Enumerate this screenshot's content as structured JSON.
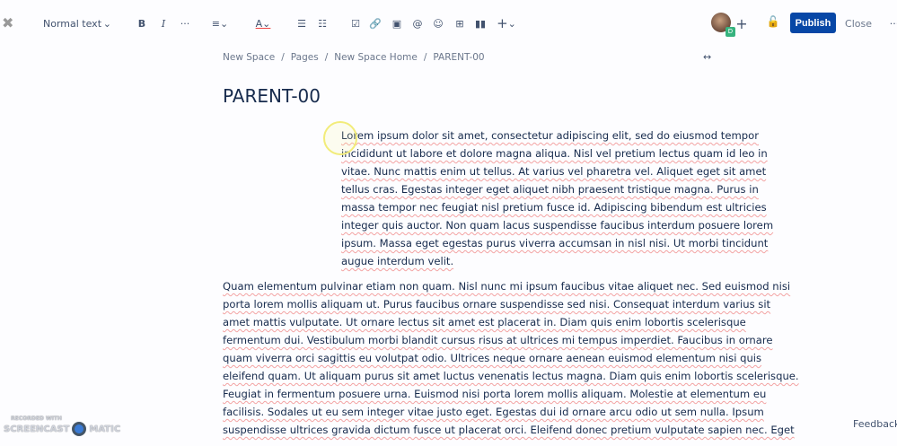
{
  "toolbar": {
    "text_style": "Normal text",
    "bold": "B",
    "italic": "I",
    "more": "···",
    "plus": "+"
  },
  "header": {
    "publish": "Publish",
    "close": "Close",
    "avatar_badge": "D"
  },
  "breadcrumb": [
    "New Space",
    "Pages",
    "New Space Home",
    "PARENT-00"
  ],
  "page_title": "PARENT-00",
  "paragraphs": [
    {
      "lines": [
        "Lorem ipsum dolor sit amet, consectetur adipiscing elit, sed do eiusmod tempor",
        "incididunt ut labore et dolore magna aliqua. Nisl vel pretium lectus quam id leo in",
        "vitae. Nunc mattis enim ut tellus. At varius vel pharetra vel. Aliquet eget sit amet",
        "tellus cras. Egestas integer eget aliquet nibh praesent tristique magna. Purus in",
        "massa tempor nec feugiat nisl pretium fusce id. Adipiscing bibendum est ultricies",
        "integer quis auctor. Non quam lacus suspendisse faucibus interdum posuere lorem",
        "ipsum. Massa eget egestas purus viverra accumsan in nisl nisi. Ut morbi tincidunt",
        "augue interdum velit."
      ]
    },
    {
      "lines": [
        "Quam elementum pulvinar etiam non quam. Nisl nunc mi ipsum faucibus vitae aliquet nec. Sed euismod nisi",
        "porta lorem mollis aliquam ut. Purus faucibus ornare suspendisse sed nisi. Consequat interdum varius sit",
        "amet mattis vulputate. Ut ornare lectus sit amet est placerat in. Diam quis enim lobortis scelerisque",
        "fermentum dui. Vestibulum morbi blandit cursus risus at ultrices mi tempus imperdiet. Faucibus in ornare",
        "quam viverra orci sagittis eu volutpat odio. Ultrices neque ornare aenean euismod elementum nisi quis",
        "eleifend quam. Ut aliquam purus sit amet luctus venenatis lectus magna. Diam quis enim lobortis scelerisque.",
        "Feugiat in fermentum posuere urna. Euismod nisi porta lorem mollis aliquam. Molestie at elementum eu",
        "facilisis. Sodales ut eu sem integer vitae justo eget. Egestas dui id ornare arcu odio ut sem nulla. Ipsum",
        "suspendisse ultrices gravida dictum fusce ut placerat orci. Eleifend donec pretium vulputate sapien nec. Eget"
      ]
    }
  ],
  "feedback": "Feedback",
  "watermark": {
    "line1": "RECORDED WITH",
    "line2": "SCREENCAST",
    "line3": "MATIC"
  }
}
